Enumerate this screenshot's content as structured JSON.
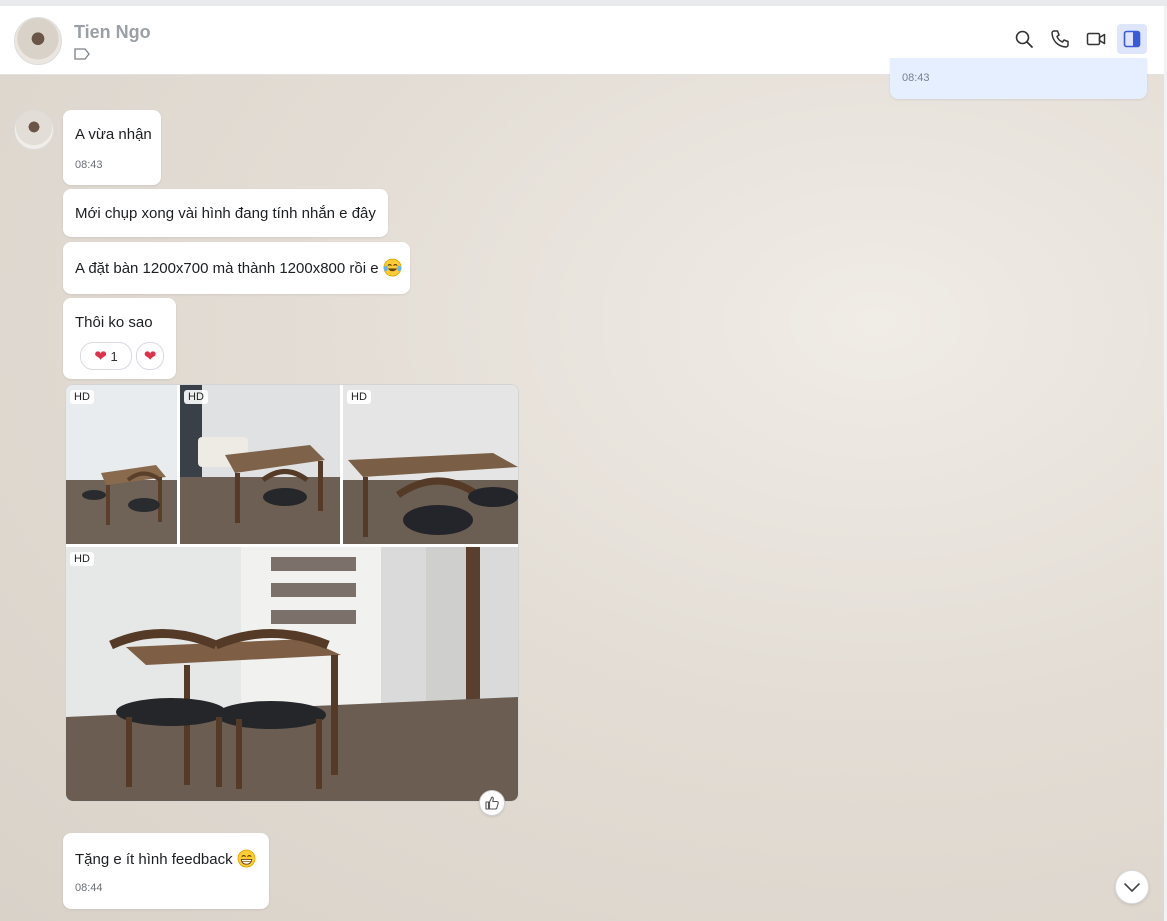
{
  "header": {
    "contact_name": "Tien Ngo",
    "icons": [
      "tag-icon",
      "search-icon",
      "phone-icon",
      "video-call-icon",
      "sidebar-toggle-icon"
    ]
  },
  "sent_message": {
    "time": "08:43"
  },
  "messages": [
    {
      "text": "A vừa nhận",
      "time": "08:43"
    },
    {
      "text": "Mới chụp xong vài hình đang tính nhắn e đây"
    },
    {
      "text": "A đặt bàn 1200x700 mà thành 1200x800 rồi e",
      "emoji": "laughing-tears-emoji"
    },
    {
      "text": "Thôi ko sao",
      "reaction_count": "1"
    },
    {
      "text": "Tặng e ít hình feedback",
      "emoji": "grinning-emoji",
      "time": "08:44"
    }
  ],
  "photos": {
    "badge": "HD",
    "count": 4
  },
  "colors": {
    "accent": "#3a5bd9",
    "sent_bubble": "#e5efff",
    "heart": "#e0314b"
  }
}
